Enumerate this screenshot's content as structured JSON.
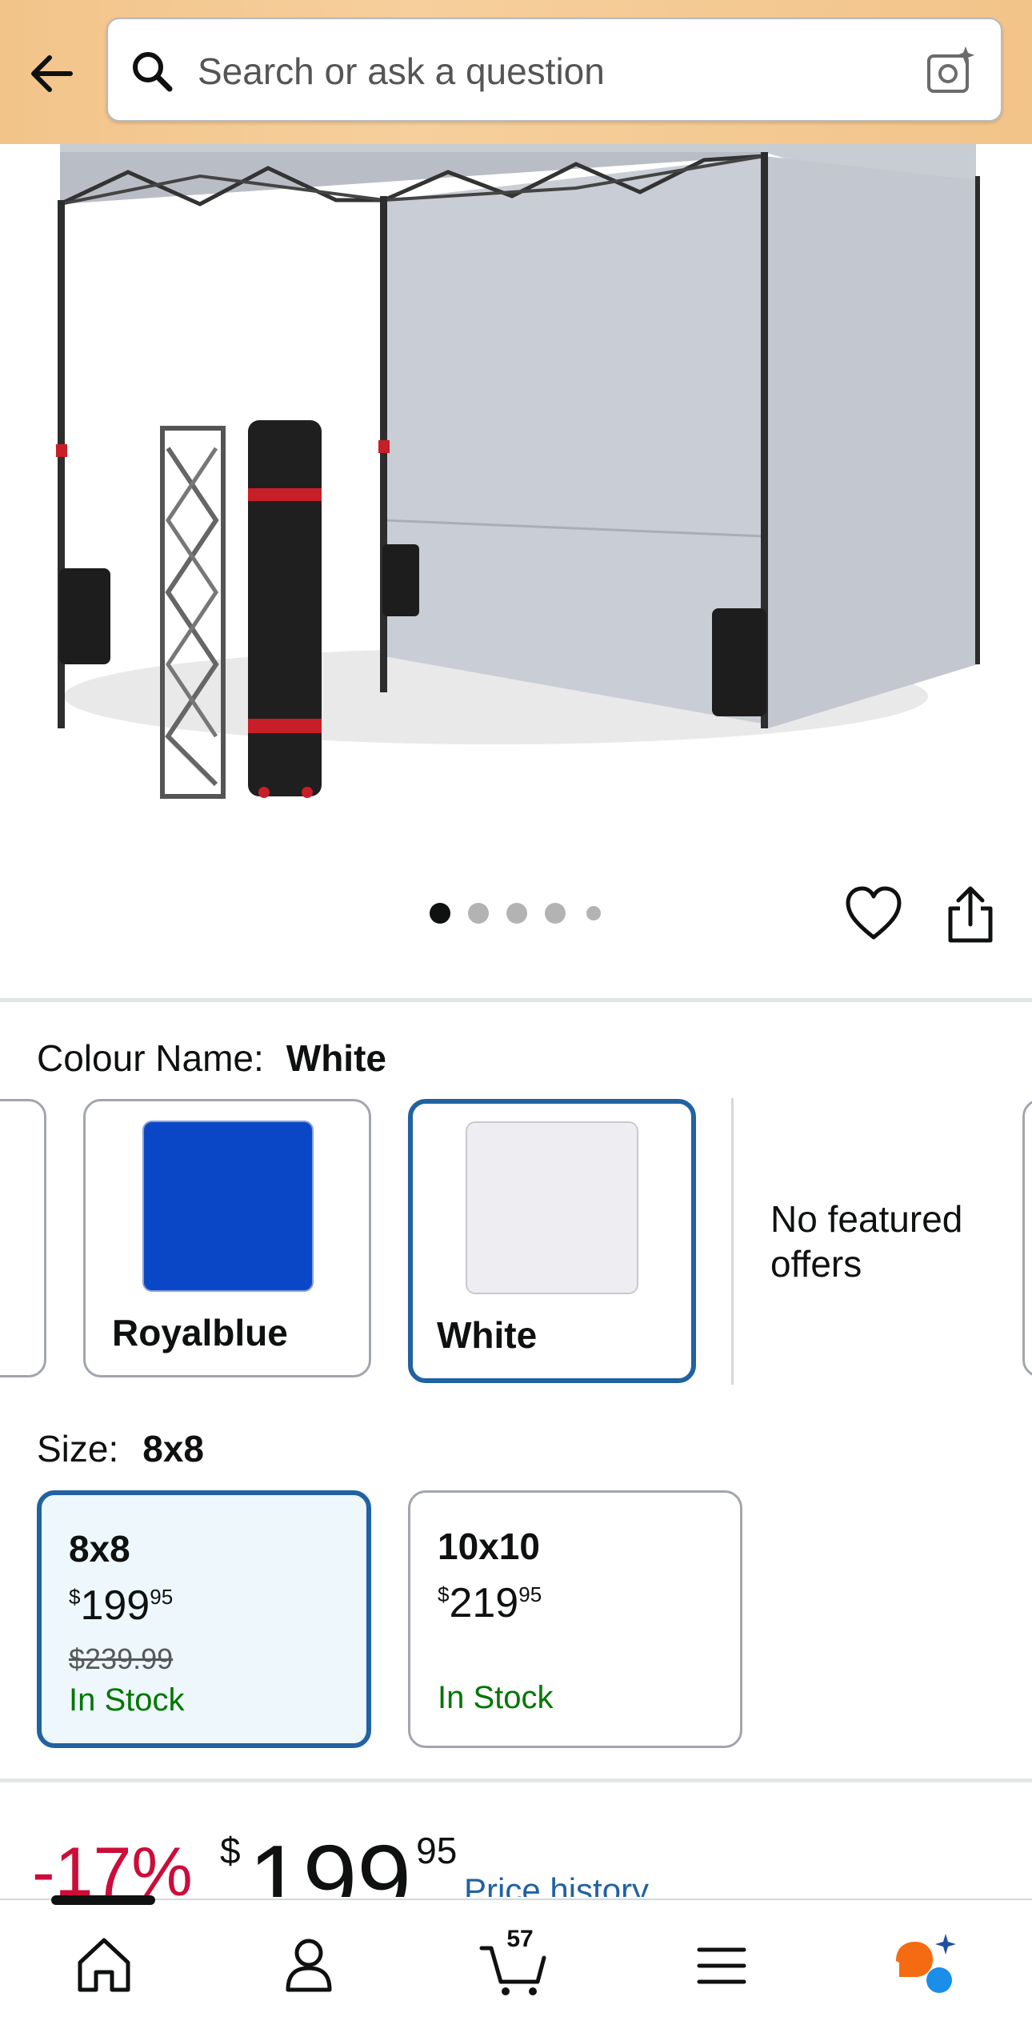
{
  "search": {
    "placeholder": "Search or ask a question"
  },
  "gallery": {
    "image_count": 5,
    "active_index": 0
  },
  "colour": {
    "label": "Colour Name:",
    "selected": "White",
    "options": [
      {
        "name": "",
        "color": "#ffffff"
      },
      {
        "name": "Royalblue",
        "color": "#0a47c7"
      },
      {
        "name": "White",
        "color": "#eeeef2"
      }
    ],
    "no_offers_text": "No featured offers"
  },
  "size": {
    "label": "Size:",
    "selected": "8x8",
    "options": [
      {
        "name": "8x8",
        "price_symbol": "$",
        "price_whole": "199",
        "price_fraction": "95",
        "list_price": "$239.99",
        "stock": "In Stock"
      },
      {
        "name": "10x10",
        "price_symbol": "$",
        "price_whole": "219",
        "price_fraction": "95",
        "list_price": "",
        "stock": "In Stock"
      }
    ]
  },
  "price": {
    "discount": "-17%",
    "symbol": "$",
    "whole": "199",
    "fraction": "95",
    "history_link": "Price history"
  },
  "nav": {
    "cart_count": "57",
    "items": [
      "home-icon",
      "account-icon",
      "cart-icon",
      "menu-icon",
      "assistant-icon"
    ]
  },
  "colors": {
    "header": "#f2c48a",
    "selected_border": "#2162a1",
    "in_stock": "#007600",
    "discount": "#cc0c39",
    "link": "#2162a1"
  }
}
